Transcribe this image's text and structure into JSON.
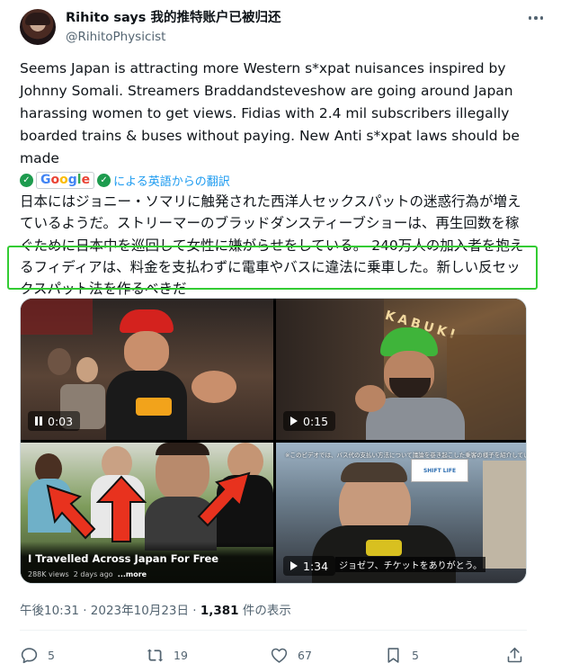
{
  "author": {
    "name": "Rihito says 我的推特账户已被归还",
    "handle": "@RihitoPhysicist"
  },
  "tweet": {
    "text": "Seems Japan is attracting more Western s*xpat nuisances inspired by Johnny Somali. Streamers Braddandsteveshow are going around Japan harassing women to get views. Fidias with 2.4 mil subscribers illegally boarded trains & buses without paying. New Anti s*xpat laws should be made",
    "translation_label": "による英語からの翻訳",
    "google_label": "Google",
    "translated_text": "日本にはジョニー・ソマリに触発された西洋人セックスパットの迷惑行為が増えているようだ。ストリーマーのブラッドダンスティーブショーは、再生回数を稼ぐために日本中を巡回して女性に嫌がらせをしている。 240万人の加入者を抱えるフィディアは、料金を支払わずに電車やバスに違法に乗車した。新しい反セックスパット法を作るべきだ"
  },
  "media": {
    "video1_time": "0:03",
    "video2_time": "0:15",
    "video3_title": "I Travelled Across Japan For Free",
    "video3_views": "288K views",
    "video3_ago": "2 days ago",
    "video3_more": "...more",
    "video4_time": "1:34",
    "video4_caption": "ジョゼフ、チケットをありがとう。",
    "video4_subtitle": "※このビデオでは、バス代の支払い方法について議論を巻き起こした乗客の様子を紹介しています。",
    "video4_sign": "SHIFT LIFE",
    "video2_sign": "KABUKI"
  },
  "meta": {
    "time": "午後10:31 · 2023年10月23日 · ",
    "views": "1,381",
    "views_label": " 件の表示"
  },
  "actions": {
    "replies": "5",
    "reposts": "19",
    "likes": "67",
    "bookmarks": "5"
  },
  "colors": {
    "accent": "#1d9bf0",
    "highlight": "#33cc33",
    "arrow": "#e8321e"
  }
}
